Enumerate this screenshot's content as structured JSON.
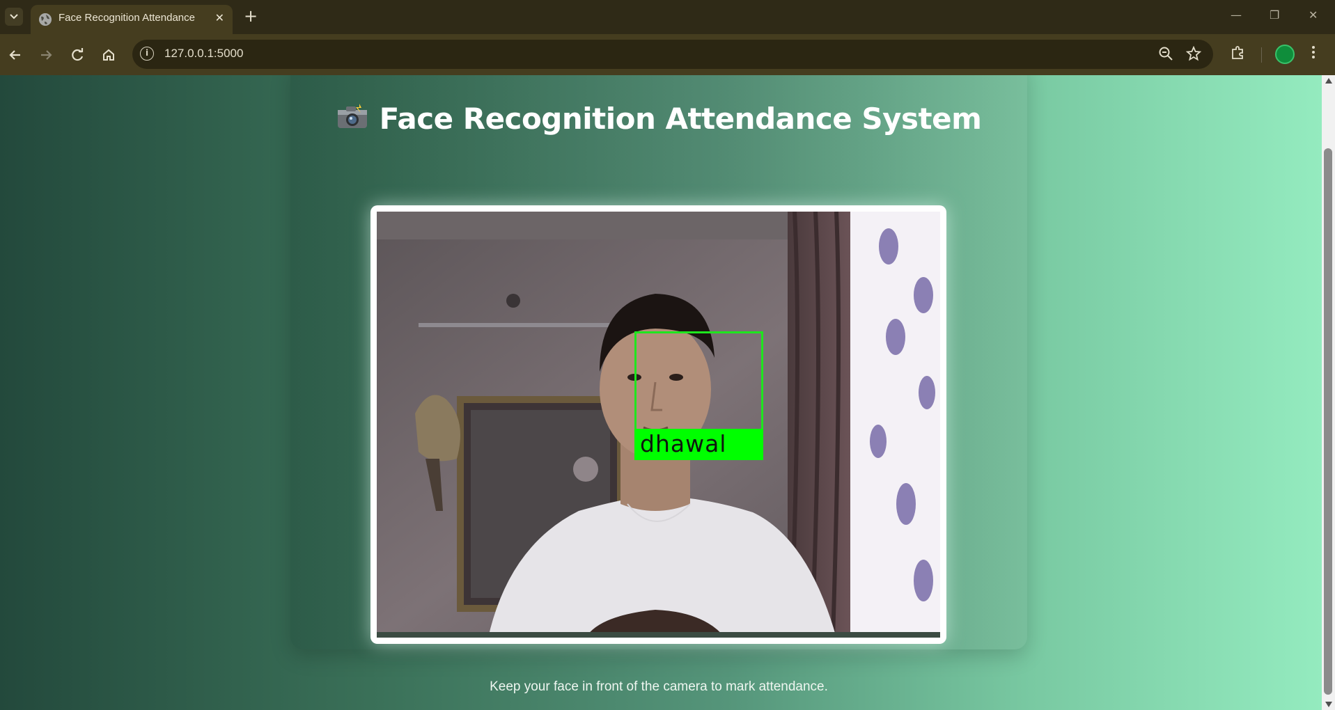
{
  "browser": {
    "tab_title": "Face Recognition Attendance",
    "url": "127.0.0.1:5000",
    "icons": {
      "tab_search": "chevron-down-icon",
      "favicon": "globe-icon",
      "close_tab": "close-icon",
      "new_tab": "plus-icon",
      "back": "arrow-left-icon",
      "forward": "arrow-right-icon",
      "reload": "reload-icon",
      "home": "home-icon",
      "site_info": "info-icon",
      "zoom": "zoom-out-icon",
      "bookmark": "star-icon",
      "extensions": "puzzle-icon",
      "profile": "avatar",
      "menu": "kebab-menu-icon",
      "minimize": "minimize-icon",
      "maximize": "restore-icon",
      "close_window": "close-icon"
    }
  },
  "page": {
    "title": "Face Recognition Attendance System",
    "title_icon": "camera-flash-icon",
    "video_feed": {
      "detected_name": "dhawal",
      "box_color": "#00ff00"
    },
    "hint": "Keep your face in front of the camera to mark attendance."
  },
  "colors": {
    "gradient_left": "#23493c",
    "gradient_right": "#94ebbf",
    "chrome": "#453d1f"
  }
}
